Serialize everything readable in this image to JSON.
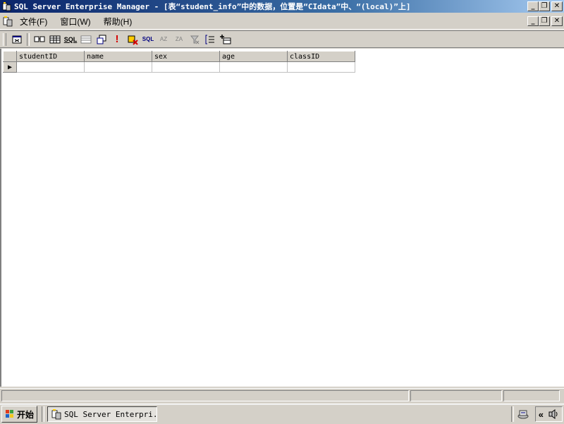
{
  "window": {
    "title": "SQL Server Enterprise Manager - [表“student_info”中的数据，位置是“CIdata”中、“(local)”上]",
    "minimize_glyph": "_",
    "restore_glyph": "❐",
    "close_glyph": "✕"
  },
  "menu": {
    "items": [
      {
        "label": "文件(F)"
      },
      {
        "label": "窗口(W)"
      },
      {
        "label": "帮助(H)"
      }
    ]
  },
  "toolbar": {
    "buttons": [
      {
        "icon": "properties-icon"
      },
      {
        "icon": "show-diagram-pane-icon"
      },
      {
        "icon": "show-grid-pane-icon"
      },
      {
        "icon": "show-sql-pane-icon",
        "label": "SQL"
      },
      {
        "icon": "show-results-pane-icon"
      },
      {
        "icon": "change-query-type-icon"
      },
      {
        "icon": "run-icon",
        "label": "!"
      },
      {
        "icon": "cancel-query-icon"
      },
      {
        "icon": "verify-sql-icon",
        "label": "SQL"
      },
      {
        "icon": "sort-ascending-icon",
        "label": "AZ"
      },
      {
        "icon": "sort-descending-icon",
        "label": "ZA"
      },
      {
        "icon": "remove-filter-icon"
      },
      {
        "icon": "group-by-icon"
      },
      {
        "icon": "add-table-icon"
      }
    ]
  },
  "grid": {
    "columns": [
      "studentID",
      "name",
      "sex",
      "age",
      "classID"
    ],
    "rows": [
      [
        "",
        "",
        "",
        "",
        ""
      ]
    ],
    "current_row_marker": "▶"
  },
  "taskbar": {
    "start_label": "开始",
    "task_label": "SQL Server Enterpri...",
    "tray_chevron": "«"
  },
  "colors": {
    "title_bar_start": "#0a246a",
    "title_bar_end": "#a6caf0",
    "face": "#d4d0c8",
    "run_icon": "#d40000"
  }
}
